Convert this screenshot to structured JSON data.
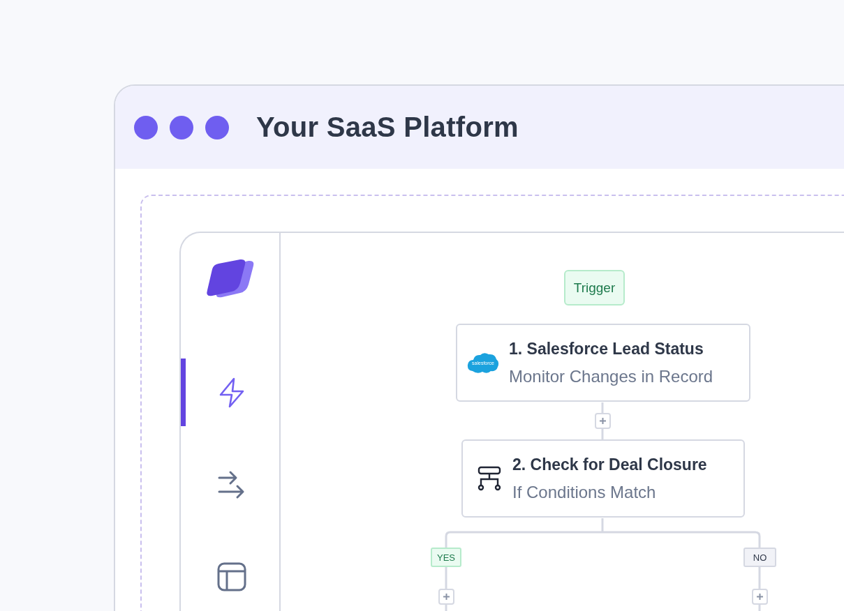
{
  "window": {
    "title": "Your SaaS Platform"
  },
  "sidebar": {
    "items": [
      {
        "kind": "bolt",
        "selected": true
      },
      {
        "kind": "arrows",
        "selected": false
      },
      {
        "kind": "layout",
        "selected": false
      }
    ]
  },
  "workflow": {
    "trigger_label": "Trigger",
    "steps": [
      {
        "kind": "salesforce",
        "title": "1. Salesforce Lead Status",
        "subtitle": "Monitor Changes in Record",
        "logo_text": "salesforce"
      },
      {
        "kind": "branch",
        "title": "2. Check for Deal Closure",
        "subtitle": "If Conditions Match"
      }
    ],
    "branches": [
      {
        "kind": "yes",
        "label": "YES"
      },
      {
        "kind": "no",
        "label": "NO"
      }
    ]
  }
}
